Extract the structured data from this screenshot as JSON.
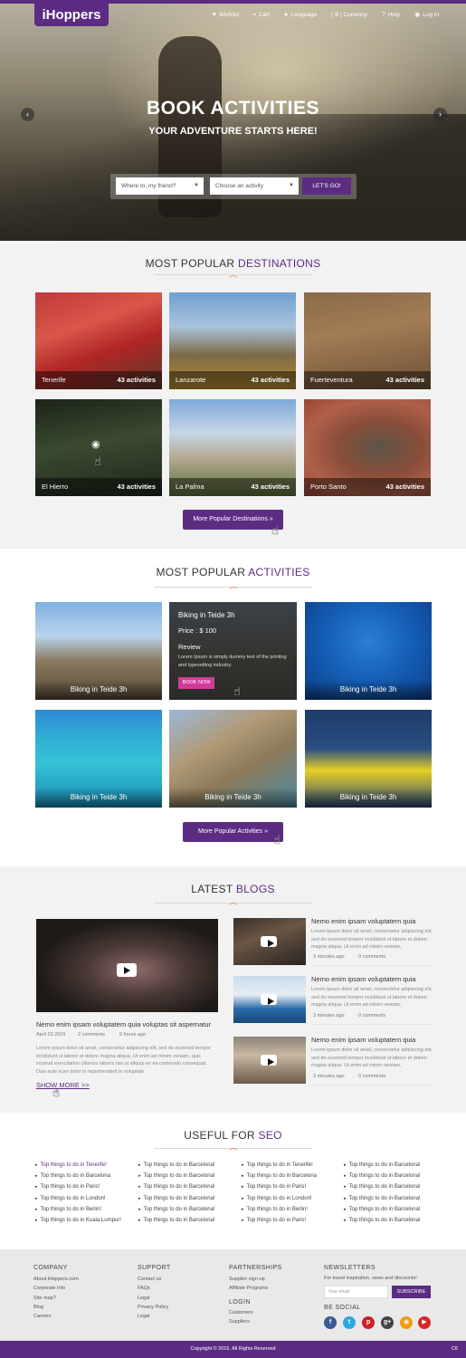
{
  "header": {
    "logo": "iHoppers",
    "nav": [
      {
        "icon": "heart-icon",
        "glyph": "♥",
        "label": "Wishlist"
      },
      {
        "icon": "cart-icon",
        "glyph": "🛒",
        "label": "Cart"
      },
      {
        "icon": "globe-icon",
        "glyph": "🌐",
        "label": "Language"
      },
      {
        "icon": "currency-icon",
        "glyph": "",
        "label": "( $ )  Currency"
      },
      {
        "icon": "help-icon",
        "glyph": "?",
        "label": "Help"
      },
      {
        "icon": "user-icon",
        "glyph": "👤",
        "label": "Log in"
      }
    ]
  },
  "hero": {
    "title": "BOOK ACTIVITIES",
    "subtitle": "YOUR ADVENTURE STARTS HERE!",
    "destination_placeholder": "Where to, my friend?",
    "activity_placeholder": "Choose an activity",
    "go_label": "LET'S GO!"
  },
  "destinations": {
    "title_plain": "MOST POPULAR ",
    "title_accent": "DESTINATIONS",
    "items": [
      {
        "name": "Tenerife",
        "count": "43 activities"
      },
      {
        "name": "Lanzarote",
        "count": "43 activities"
      },
      {
        "name": "Fuerteventura",
        "count": "43 activities"
      },
      {
        "name": "El Hierro",
        "count": "43 activities"
      },
      {
        "name": "La Palma",
        "count": "43 activities"
      },
      {
        "name": "Porto Santo",
        "count": "43 activities"
      }
    ],
    "more_label": "More Popular Destinations »"
  },
  "activities": {
    "title_plain": "MOST POPULAR ",
    "title_accent": "ACTIVITIES",
    "items": [
      {
        "name": "Biking in Teide 3h"
      },
      {
        "name": "Biking in Teide 3h"
      },
      {
        "name": "Biking in Teide 3h"
      },
      {
        "name": "Biking in Teide 3h"
      },
      {
        "name": "Biking in Teide 3h"
      },
      {
        "name": "Biking in Teide 3h"
      }
    ],
    "hover": {
      "title": "Biking in Teide 3h",
      "price": "Price : $ 100",
      "review_label": "Review",
      "review_text": "Lorem Ipsum is simply dummy text of the printing and typesetting industry.",
      "book_label": "BOOK NOW"
    },
    "more_label": "More Popular Activities »"
  },
  "blogs": {
    "title_plain": "LATEST ",
    "title_accent": "BLOGS",
    "main": {
      "title": "Nemo enim ipsam voluptatem quia voluptas sit aspernatur",
      "date": "April 23 2015",
      "comments": "2 comments",
      "ago": "6 hours ago",
      "excerpt": "Lorem ipsum dolor sit amet, consectetur adipiscing elit, sed do eiusmod tempor incididunt ut labore et dolore magna aliqua. Ut enim ad minim veniam, quis nostrud exercitation ullamco laboris nisi ut aliquip ex ea commodo consequat. Duis aute irure dolor in reprehenderit in voluptate",
      "show_more": "SHOW MORE >>"
    },
    "side": [
      {
        "title": "Nemo enim ipsam voluptatem quia",
        "excerpt": "Lorem ipsum dolor sit amet, consectetur adipiscing elit, sed do eiusmod tempor incididunt ut labore et dolore magna aliqua. Ut enim ad minim veniam,",
        "ago": "3 minutes ago",
        "comments": "0 comments"
      },
      {
        "title": "Nemo enim ipsam voluptatem quia",
        "excerpt": "Lorem ipsum dolor sit amet, consectetur adipiscing elit, sed do eiusmod tempor incididunt ut labore et dolore magna aliqua. Ut enim ad minim veniam,",
        "ago": "3 minutes ago",
        "comments": "0 comments"
      },
      {
        "title": "Nemo enim ipsam voluptatem quia",
        "excerpt": "Lorem ipsum dolor sit amet, consectetur adipiscing elit, sed do eiusmod tempor incididunt ut labore et dolore magna aliqua. Ut enim ad minim veniam,",
        "ago": "3 minutes ago",
        "comments": "0 comments"
      }
    ]
  },
  "seo": {
    "title_plain": "USEFUL FOR ",
    "title_accent": "SEO",
    "columns": [
      [
        "Top things to do in Tenerife!",
        "Top things to do in Barcelona",
        "Top things to do in Paris!",
        "Top things to do in London!",
        "Top things to do in Berlin!",
        "Top things to do in Kuala Lumpur!"
      ],
      [
        "Top things to do in Barcelona!",
        "Top things to do in Barcelona!",
        "Top things to do in Barcelona!",
        "Top things to do in Barcelona!",
        "Top things to do in Barcelona!",
        "Top things to do in Barcelona!"
      ],
      [
        "Top things to do in Tenerife!",
        "Top things to do in Barcelona",
        "Top things to do in Paris!",
        "Top things to do in London!",
        "Top things to do in Berlin!",
        "Top things to do in Paris!"
      ],
      [
        "Top things to do in Barcelona!",
        "Top things to do in Barcelona!",
        "Top things to do in Barcelona!",
        "Top things to do in Barcelona!",
        "Top things to do in Barcelona!",
        "Top things to do in Barcelona!"
      ]
    ]
  },
  "footer": {
    "company": {
      "heading": "COMPANY",
      "links": [
        "About iHoppers.com",
        "Corporate Info",
        "Site map?",
        "Blog",
        "Careers"
      ]
    },
    "support": {
      "heading": "SUPPORT",
      "links": [
        "Contact us",
        "FAQs",
        "Legal",
        "Privacy Policy",
        "Legal"
      ]
    },
    "partnerships": {
      "heading": "PARTNERSHIPS",
      "links": [
        "Supplier sign-up",
        "Affiliate Programs"
      ]
    },
    "login": {
      "heading": "LOGIN",
      "links": [
        "Customers",
        "Suppliers"
      ]
    },
    "newsletters": {
      "heading": "NEWSLETTERS",
      "text": "For travel inspiration, news and discounts!",
      "email_placeholder": "Your email",
      "subscribe_label": "SUBSCRIBE"
    },
    "social": {
      "heading": "BE SOCIAL",
      "items": [
        {
          "icon": "facebook-icon",
          "glyph": "f",
          "color": "#3b5998"
        },
        {
          "icon": "twitter-icon",
          "glyph": "t",
          "color": "#2aa9e0"
        },
        {
          "icon": "pinterest-icon",
          "glyph": "p",
          "color": "#cb2027"
        },
        {
          "icon": "googleplus-icon",
          "glyph": "g+",
          "color": "#444444"
        },
        {
          "icon": "rss-icon",
          "glyph": "◉",
          "color": "#f39c12"
        },
        {
          "icon": "youtube-icon",
          "glyph": "▶",
          "color": "#d62828"
        }
      ]
    },
    "copyright": "Copyright © 2015. All Rights Reserved",
    "version": "C6"
  },
  "colors": {
    "brand": "#5b2c82",
    "accent": "#e07a2e",
    "book": "#d43a9b"
  }
}
